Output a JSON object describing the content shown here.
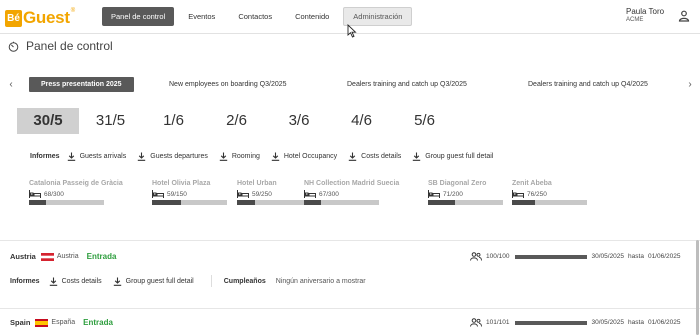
{
  "header": {
    "logo_badge": "Bé",
    "logo_text": "Guest",
    "logo_mark": "®",
    "nav": [
      "Panel de control",
      "Eventos",
      "Contactos",
      "Contenido",
      "Administración"
    ],
    "user_name": "Paula Toro",
    "company": "ACME"
  },
  "page": {
    "title": "Panel de control",
    "icon": "speedometer-icon"
  },
  "events": {
    "prev_arrow": "‹",
    "next_arrow": "›",
    "tabs": [
      "Press presentation 2025",
      "New employees on boarding Q3/2025",
      "Dealers training and catch up Q3/2025",
      "Dealers training and catch up Q4/2025"
    ]
  },
  "dates": [
    "30/5",
    "31/5",
    "1/6",
    "2/6",
    "3/6",
    "4/6",
    "5/6"
  ],
  "reports": {
    "label": "Informes",
    "links": [
      "Guests arrivals",
      "Guests departures",
      "Rooming",
      "Hotel Occupancy",
      "Costs details",
      "Group guest full detail"
    ]
  },
  "hotels": [
    {
      "name": "Catalonia Passeig de Gràcia",
      "capacity": "68/300",
      "occupancy": 0.23
    },
    {
      "name": "Hotel Olivia Plaza",
      "capacity": "59/150",
      "occupancy": 0.39
    },
    {
      "name": "Hotel Urban",
      "capacity": "59/250",
      "occupancy": 0.24
    },
    {
      "name": "NH Collection Madrid Suecia",
      "capacity": "67/300",
      "occupancy": 0.22
    },
    {
      "name": "SB Diagonal Zero",
      "capacity": "71/200",
      "occupancy": 0.36
    },
    {
      "name": "Zenit Abeba",
      "capacity": "76/250",
      "occupancy": 0.3
    }
  ],
  "countries": [
    {
      "name": "Austria",
      "local_name": "Austria",
      "status": "Entrada",
      "count": "100/100",
      "date_from": "30/05/2025",
      "separator": "hasta",
      "date_to": "01/06/2025"
    },
    {
      "name": "Spain",
      "local_name": "España",
      "status": "Entrada",
      "count": "101/101",
      "date_from": "30/05/2025",
      "separator": "hasta",
      "date_to": "01/06/2025"
    }
  ],
  "austria_reports": {
    "label": "Informes",
    "links": [
      "Costs details",
      "Group guest full detail"
    ],
    "birthdays_label": "Cumpleaños",
    "birthdays_text": "Ningún aniversario a mostrar"
  },
  "colors": {
    "accent": "#f2a500",
    "active_nav": "#595959",
    "status_green": "#2e9e3e"
  }
}
